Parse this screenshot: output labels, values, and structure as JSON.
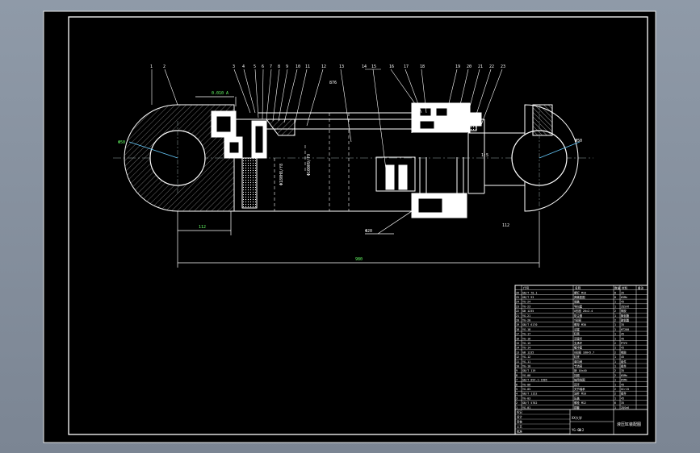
{
  "drawing": {
    "balloons_left": [
      "1",
      "2",
      "3",
      "4",
      "5",
      "6",
      "7",
      "8",
      "9",
      "10",
      "11",
      "12",
      "13"
    ],
    "balloons_right": [
      "14",
      "15",
      "16",
      "17",
      "18",
      "19",
      "20",
      "21",
      "22",
      "23",
      "24",
      "25",
      "26"
    ],
    "dim_stroke": "876",
    "dim_total": "980",
    "dim_offset": "112",
    "dim_side": "112",
    "dia_left": "Φ50",
    "dia_right": "Φ50",
    "bore_label": "Φ180H8/f8",
    "rod_label": "Φ100H9/f9",
    "tol_label": "0.010 A",
    "leader_label": "Φ20",
    "ratio_label": "1:5"
  },
  "title_block": {
    "header_code": "代号",
    "header_name": "名称",
    "header_qty": "数量",
    "header_mat": "材料",
    "header_note": "备注",
    "rows": [
      {
        "no": "26",
        "code": "GB/T 70.1",
        "name": "螺钉 M10",
        "qty": "8",
        "mat": "35"
      },
      {
        "no": "25",
        "code": "GB/T 93",
        "name": "弹簧垫圈",
        "qty": "8",
        "mat": "65Mn"
      },
      {
        "no": "24",
        "code": "YG-24",
        "name": "端盖",
        "qty": "1",
        "mat": "45"
      },
      {
        "no": "23",
        "code": "YG-23",
        "name": "导向套",
        "qty": "1",
        "mat": "ZQSn6"
      },
      {
        "no": "22",
        "code": "GB 1235",
        "name": "O形圈 20×2.4",
        "qty": "2",
        "mat": "橡胶"
      },
      {
        "no": "21",
        "code": "YG-21",
        "name": "防尘圈",
        "qty": "1",
        "mat": "聚氨酯"
      },
      {
        "no": "20",
        "code": "YG-20",
        "name": "Y形圈",
        "qty": "2",
        "mat": "聚氨酯"
      },
      {
        "no": "19",
        "code": "GB/T 6170",
        "name": "螺母 M30",
        "qty": "1",
        "mat": "35"
      },
      {
        "no": "18",
        "code": "YG-18",
        "name": "活塞",
        "qty": "1",
        "mat": "HT200"
      },
      {
        "no": "17",
        "code": "YG-17",
        "name": "缸筒",
        "qty": "1",
        "mat": "45"
      },
      {
        "no": "16",
        "code": "YG-16",
        "name": "活塞杆",
        "qty": "1",
        "mat": "45"
      },
      {
        "no": "15",
        "code": "YG-15",
        "name": "支承环",
        "qty": "2",
        "mat": "PTFE"
      },
      {
        "no": "14",
        "code": "YG-14",
        "name": "缓冲套",
        "qty": "1",
        "mat": "45"
      },
      {
        "no": "13",
        "code": "GB 1235",
        "name": "O形圈 180×5.7",
        "qty": "2",
        "mat": "橡胶"
      },
      {
        "no": "12",
        "code": "YG-12",
        "name": "缸底",
        "qty": "1",
        "mat": "45"
      },
      {
        "no": "11",
        "code": "YG-11",
        "name": "单向阀",
        "qty": "1",
        "mat": "组件"
      },
      {
        "no": "10",
        "code": "YG-10",
        "name": "节流阀",
        "qty": "1",
        "mat": "组件"
      },
      {
        "no": "9",
        "code": "GB/T 119",
        "name": "销 10×40",
        "qty": "2",
        "mat": "35"
      },
      {
        "no": "8",
        "code": "YG-08",
        "name": "挡圈",
        "qty": "2",
        "mat": "65Mn"
      },
      {
        "no": "7",
        "code": "GB/T 894.1-1986",
        "name": "轴用挡圈",
        "qty": "1",
        "mat": "65Mn"
      },
      {
        "no": "6",
        "code": "YG-06",
        "name": "耳环",
        "qty": "1",
        "mat": "45"
      },
      {
        "no": "5",
        "code": "YG-05",
        "name": "关节轴承",
        "qty": "2",
        "mat": "GCr15"
      },
      {
        "no": "4",
        "code": "GB/T 1152",
        "name": "油杯 M10",
        "qty": "2",
        "mat": "组件"
      },
      {
        "no": "3",
        "code": "YG-03",
        "name": "压盖",
        "qty": "1",
        "mat": "45"
      },
      {
        "no": "2",
        "code": "GB/T 5782",
        "name": "螺栓 M12",
        "qty": "6",
        "mat": "35"
      },
      {
        "no": "1",
        "code": "YG-01",
        "name": "铜套",
        "qty": "1",
        "mat": "ZQSn6"
      }
    ],
    "sign_labels": [
      "标记",
      "设计",
      "审核",
      "工艺",
      "批准"
    ],
    "company": "XX大学",
    "drawing_title": "液压缸装配图",
    "drawing_no": "YG-00",
    "scale": "1:2"
  }
}
